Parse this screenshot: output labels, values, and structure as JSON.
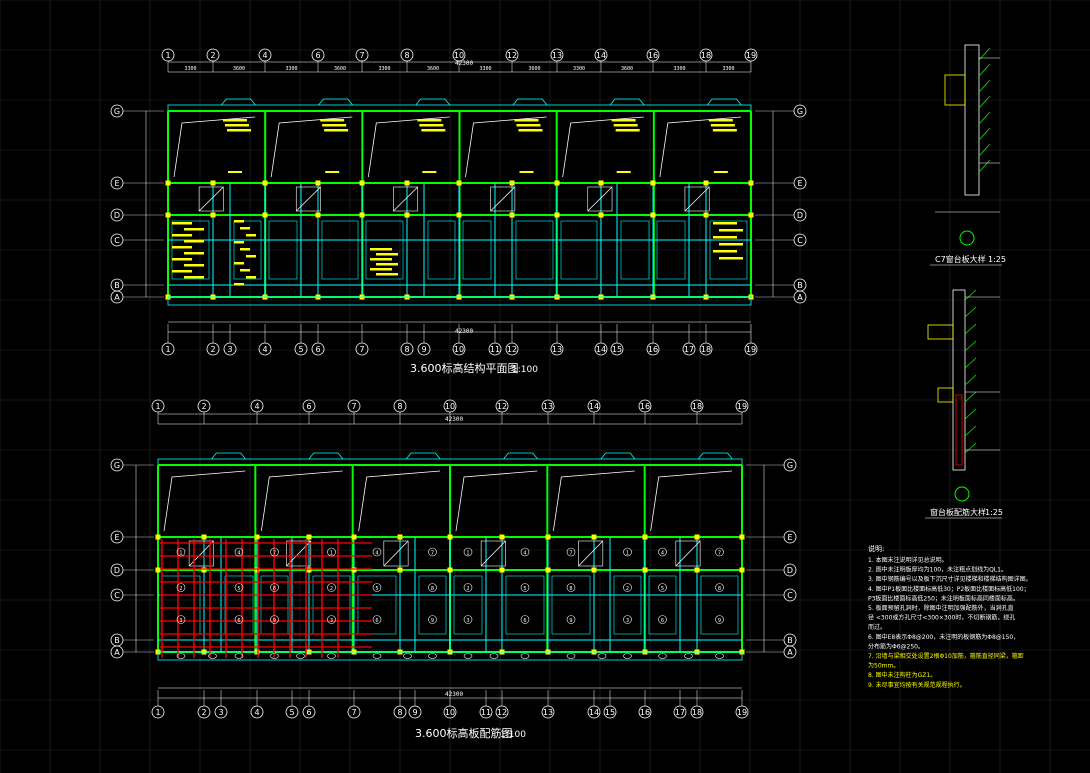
{
  "colors": {
    "background": "#000000",
    "grid": "#2a2a2a",
    "wall": "#00ff00",
    "beam": "#00ffff",
    "column": "#ffff00",
    "rebar": "#ff0000",
    "dimension": "#ffffff",
    "text": "#ffffff",
    "note_yellow": "#ffff00"
  },
  "plan_top": {
    "title": "3.600标高结构平面图",
    "scale": "1:100",
    "axes_top": [
      "1",
      "2",
      "4",
      "6",
      "7",
      "8",
      "10",
      "12",
      "13",
      "14",
      "16",
      "18",
      "19"
    ],
    "axes_bottom": [
      "1",
      "2",
      "3",
      "4",
      "5",
      "6",
      "7",
      "8",
      "9",
      "10",
      "11",
      "12",
      "13",
      "14",
      "15",
      "16",
      "17",
      "18",
      "19"
    ],
    "axes_side": [
      "G",
      "E",
      "D",
      "C",
      "B",
      "A"
    ],
    "dims_top": [
      "3300",
      "3600",
      "3300",
      "3600",
      "3300",
      "3600",
      "3300",
      "3600",
      "3300",
      "3600",
      "3300",
      "3300"
    ],
    "total_dim": "42300"
  },
  "plan_bottom": {
    "title": "3.600标高板配筋图",
    "scale": "1:100",
    "axes_top": [
      "1",
      "2",
      "4",
      "6",
      "7",
      "8",
      "10",
      "12",
      "13",
      "14",
      "16",
      "18",
      "19"
    ],
    "axes_bottom": [
      "1",
      "2",
      "3",
      "4",
      "5",
      "6",
      "7",
      "8",
      "9",
      "10",
      "11",
      "12",
      "13",
      "14",
      "15",
      "16",
      "17",
      "18",
      "19"
    ],
    "axes_side": [
      "G",
      "E",
      "D",
      "C",
      "B",
      "A"
    ],
    "total_dim": "42300"
  },
  "detail_1": {
    "title": "C7窗台板大样",
    "scale": "1:25"
  },
  "detail_2": {
    "title": "窗台板配筋大样",
    "scale": "1:25"
  },
  "notes": {
    "heading": "说明:",
    "lines": [
      "1. 本图未注说明详见总说明。",
      "2. 图中未注明板厚均为100，未注粗点划线为QL1。",
      "3. 图中钢筋编号以及板下沉尺寸详见楼梯和楼梯结构图详图。",
      "4. 图中P1板面比楼面标高低30；P2板面比楼面标高低100；",
      "   P3板面比楼面标高低250；未注明板面标高同楼面标高。",
      "5. 板面预留孔洞时，除图中注明加强配筋外，当洞孔直",
      "   径 <300或方孔尺寸<300×300时，不切断钢筋，绕孔",
      "   而过。",
      "6. 图中E8表示Φ8@200，未注明的板钢筋为Φ8@150，",
      "   分布筋为Φ6@250。",
      "7. 沿墙与梁相交处设置2根Φ10加筋，箍筋直径同梁，箍距",
      "   为50mm。",
      "8. 图中未注构柱为GZ1。",
      "9. 未尽事宜均按有关规范规程执行。"
    ]
  }
}
